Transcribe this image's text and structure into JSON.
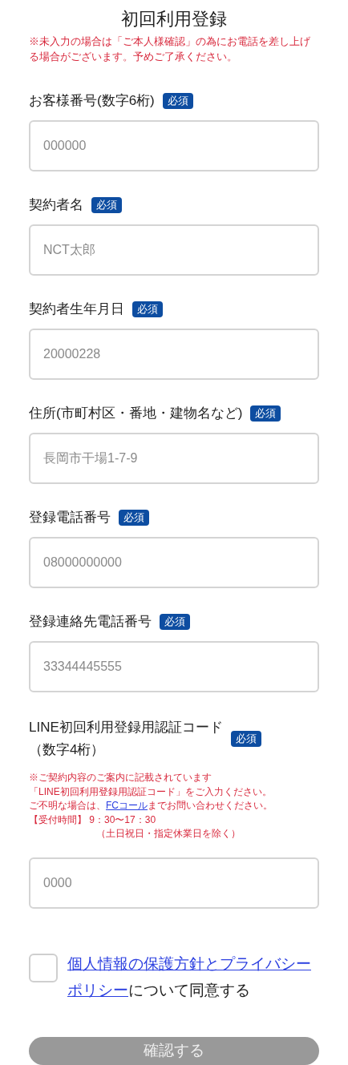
{
  "title": "初回利用登録",
  "notice": "※未入力の場合は「ご本人様確認」の為にお電話を差し上げる場合がございます。予めご了承ください。",
  "fields": [
    {
      "label": "お客様番号(数字6桁)",
      "badge": "必須",
      "placeholder": "000000"
    },
    {
      "label": "契約者名",
      "badge": "必須",
      "placeholder": "NCT太郎"
    },
    {
      "label": "契約者生年月日",
      "badge": "必須",
      "placeholder": "20000228"
    },
    {
      "label": "住所(市町村区・番地・建物名など)",
      "badge": "必須",
      "placeholder": "長岡市干場1-7-9"
    },
    {
      "label": "登録電話番号",
      "badge": "必須",
      "placeholder": "08000000000"
    },
    {
      "label": "登録連絡先電話番号",
      "badge": "必須",
      "placeholder": "33344445555"
    },
    {
      "label": "LINE初回利用登録用認証コード",
      "label_sub": "（数字4桁）",
      "badge": "必須",
      "placeholder": "0000",
      "note": [
        {
          "text": "※ご契約内容のご案内に記載されています"
        },
        {
          "text": "「LINE初回利用登録用認証コード」をご入力ください。"
        },
        {
          "text": "ご不明な場合は、",
          "link": "FCコール",
          "after": "までお問い合わせください。"
        },
        {
          "text": "【受付時間】 9：30〜17：30"
        },
        {
          "text": "（土日祝日・指定休業日を除く）",
          "indent": true
        }
      ]
    }
  ],
  "agreement": {
    "checked": false,
    "link_lines": [
      "個人情報の保護方針とプライバシー",
      "ポリシー"
    ],
    "after": "について同意する"
  },
  "submit": {
    "label": "確認する",
    "disabled": true
  }
}
